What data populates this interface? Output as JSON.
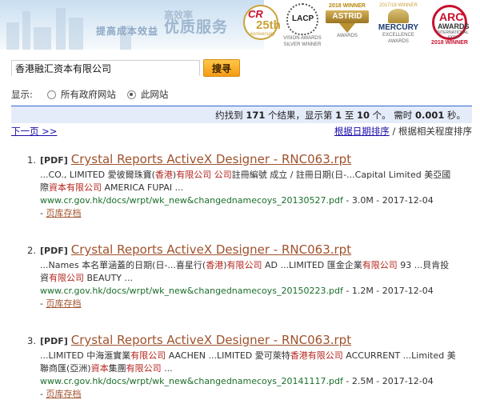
{
  "banner": {
    "slogan_left": "提高成本效益",
    "slogan_top": "高效率",
    "slogan_main": "优质服务",
    "awards": [
      {
        "icon": "cr-25th-anniversary-badge",
        "name": "CR",
        "number": "25th",
        "sub": "Anniversary"
      },
      {
        "icon": "lacp-vision-award-laurel",
        "name": "LACP",
        "sub": "VISION AWARDS SILVER WINNER"
      },
      {
        "icon": "astrid-award-trophy",
        "top": "2018 WINNER",
        "name": "ASTRID",
        "sub": "AWARDS"
      },
      {
        "icon": "mercury-award-wing",
        "top": "2017/18 WINNER",
        "name": "MERCURY",
        "sub": "EXCELLENCE AWARDS"
      },
      {
        "icon": "arc-award-emblem",
        "name": "ARC",
        "name2": "AWARDS",
        "sub": "INTERNATIONAL XXXII",
        "top": "2018 WINNER"
      }
    ]
  },
  "search": {
    "value": "香港融汇资本有限公司",
    "button_label": "搜寻"
  },
  "scope": {
    "label": "显示:",
    "options": [
      {
        "label": "所有政府网站",
        "checked": false
      },
      {
        "label": "此网站",
        "checked": true
      }
    ]
  },
  "stats": {
    "prefix": "约找到",
    "count": "171",
    "mid1": "个结果，显示第",
    "from": "1",
    "mid2": "至",
    "to": "10",
    "mid3": "个。 需时",
    "time": "0.001",
    "suffix": "秒。"
  },
  "nav": {
    "next_page": "下一页 >>",
    "sort_by_date": "根据日期排序",
    "sort_sep": " / ",
    "sort_by_relevance": "根据相关程度排序"
  },
  "results": [
    {
      "number": "1.",
      "tag": "[PDF]",
      "title": "Crystal Reports ActiveX Designer - RNC063.rpt",
      "snippet_parts": [
        {
          "t": "...CO., LIMITED 愛彼爾珠寶(",
          "h": false
        },
        {
          "t": "香港",
          "h": true
        },
        {
          "t": ")",
          "h": false
        },
        {
          "t": "有限公司 公司",
          "h": true
        },
        {
          "t": "註冊編號 成立 / 註冊日期(日-...Capital Limited 美亞國際",
          "h": false
        },
        {
          "t": "資本有限公司",
          "h": true
        },
        {
          "t": " AMERICA FUPAI ...",
          "h": false
        }
      ],
      "url": "www.cr.gov.hk/docs/wrpt/wk_new&changednamecoys_20130527.pdf",
      "meta": " - 3.0M - 2017-12-04",
      "cache_prefix": "- ",
      "cache": "页库存档"
    },
    {
      "number": "2.",
      "tag": "[PDF]",
      "title": "Crystal Reports ActiveX Designer - RNC063.rpt",
      "snippet_parts": [
        {
          "t": "...Names 本名單涵蓋的日期(日-...喜星行(",
          "h": false
        },
        {
          "t": "香港",
          "h": true
        },
        {
          "t": ")",
          "h": false
        },
        {
          "t": "有限公司",
          "h": true
        },
        {
          "t": " AD ...LIMITED 匯金企業",
          "h": false
        },
        {
          "t": "有限公司",
          "h": true
        },
        {
          "t": " 93 ...貝肯投資",
          "h": false
        },
        {
          "t": "有限公司",
          "h": true
        },
        {
          "t": " BEAUTY ...",
          "h": false
        }
      ],
      "url": "www.cr.gov.hk/docs/wrpt/wk_new&changednamecoys_20150223.pdf",
      "meta": " - 1.2M - 2017-12-04",
      "cache_prefix": "- ",
      "cache": "页库存档"
    },
    {
      "number": "3.",
      "tag": "[PDF]",
      "title": "Crystal Reports ActiveX Designer - RNC063.rpt",
      "snippet_parts": [
        {
          "t": "...LIMITED 中海滙實業",
          "h": false
        },
        {
          "t": "有限公司",
          "h": true
        },
        {
          "t": " AACHEN ...LIMITED 愛可萊特",
          "h": false
        },
        {
          "t": "香港有限公司",
          "h": true
        },
        {
          "t": " ACCURRENT ...Limited 美聯商匯(亞洲)",
          "h": false
        },
        {
          "t": "資本",
          "h": true
        },
        {
          "t": "集團",
          "h": false
        },
        {
          "t": "有限公司",
          "h": true
        },
        {
          "t": " ...",
          "h": false
        }
      ],
      "url": "www.cr.gov.hk/docs/wrpt/wk_new&changednamecoys_20141117.pdf",
      "meta": " - 2.5M - 2017-12-04",
      "cache_prefix": "- ",
      "cache": "页库存档"
    }
  ]
}
